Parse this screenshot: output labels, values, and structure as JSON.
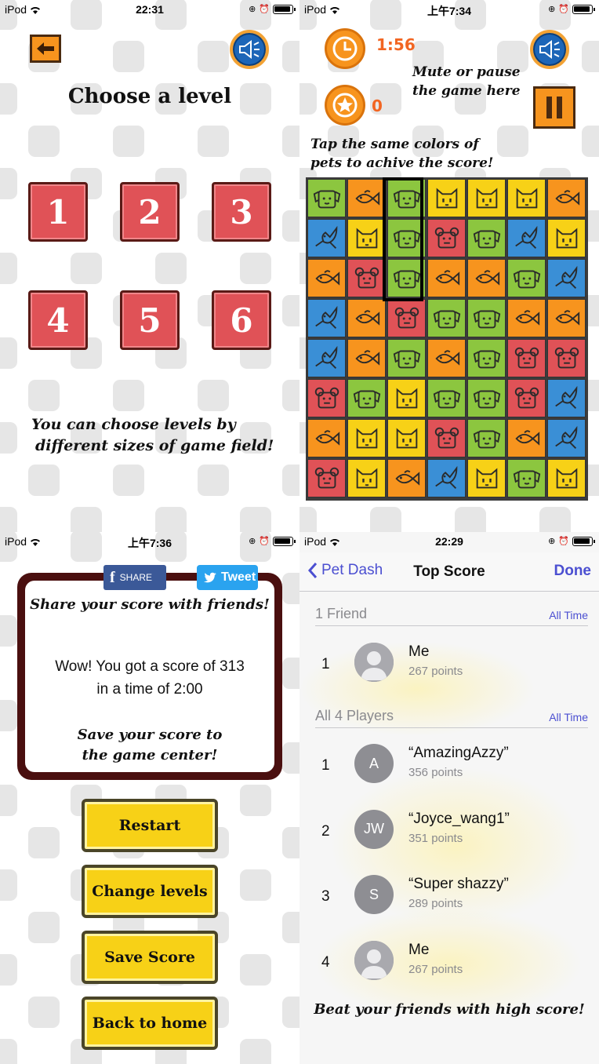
{
  "screen1": {
    "status": {
      "carrier": "iPod",
      "time": "22:31"
    },
    "title": "Choose a level",
    "levels": [
      "1",
      "2",
      "3",
      "4",
      "5",
      "6"
    ],
    "hint_line1": "You can choose levels by",
    "hint_line2": "different sizes of game field!"
  },
  "screen2": {
    "status": {
      "carrier": "iPod",
      "time": "上午7:34"
    },
    "timer": "1:56",
    "score": "0",
    "mute_hint_line1": "Mute or pause",
    "mute_hint_line2": "the game here",
    "tap_hint_line1": "Tap the same colors of",
    "tap_hint_line2": "pets to achive the score!",
    "board": [
      [
        "dog",
        "fish",
        "dog",
        "cat",
        "cat",
        "cat",
        "fish"
      ],
      [
        "bird",
        "cat",
        "dog",
        "mouse",
        "dog",
        "bird",
        "cat"
      ],
      [
        "fish",
        "mouse",
        "dog",
        "fish",
        "fish",
        "dog",
        "bird"
      ],
      [
        "bird",
        "fish",
        "mouse",
        "dog",
        "dog",
        "fish",
        "fish"
      ],
      [
        "bird",
        "fish",
        "dog",
        "fish",
        "dog",
        "mouse",
        "mouse"
      ],
      [
        "mouse",
        "dog",
        "cat",
        "dog",
        "dog",
        "mouse",
        "bird"
      ],
      [
        "fish",
        "cat",
        "cat",
        "mouse",
        "dog",
        "fish",
        "bird"
      ],
      [
        "mouse",
        "cat",
        "fish",
        "bird",
        "cat",
        "dog",
        "cat"
      ]
    ],
    "pet_colors": {
      "dog": "#8cc63f",
      "fish": "#f7941e",
      "cat": "#f7d117",
      "bird": "#3a8fd6",
      "mouse": "#e05257"
    }
  },
  "screen3": {
    "status": {
      "carrier": "iPod",
      "time": "上午7:36"
    },
    "facebook_label": "SHARE",
    "tweet_label": "Tweet",
    "share_text": "Share your score with friends!",
    "result_line1": "Wow! You got a score of 313",
    "result_line2": "in a time of  2:00",
    "save_hint_line1": "Save your score to",
    "save_hint_line2": "the game center!",
    "buttons": [
      "Restart",
      "Change levels",
      "Save Score",
      "Back to home"
    ]
  },
  "screen4": {
    "status": {
      "carrier": "iPod",
      "time": "22:29"
    },
    "back_label": "Pet Dash",
    "title": "Top Score",
    "done_label": "Done",
    "friends_section": "1 Friend",
    "friends_filter": "All Time",
    "friends": [
      {
        "rank": "1",
        "name": "Me",
        "points": "267 points",
        "avatar": ""
      }
    ],
    "players_section": "All 4 Players",
    "players_filter": "All Time",
    "players": [
      {
        "rank": "1",
        "name": "“AmazingAzzy”",
        "points": "356 points",
        "avatar": "A"
      },
      {
        "rank": "2",
        "name": "“Joyce_wang1”",
        "points": "351 points",
        "avatar": "JW"
      },
      {
        "rank": "3",
        "name": "“Super shazzy”",
        "points": "289 points",
        "avatar": "S"
      },
      {
        "rank": "4",
        "name": "Me",
        "points": "267 points",
        "avatar": ""
      }
    ],
    "footer": "Beat your friends with high score!"
  }
}
